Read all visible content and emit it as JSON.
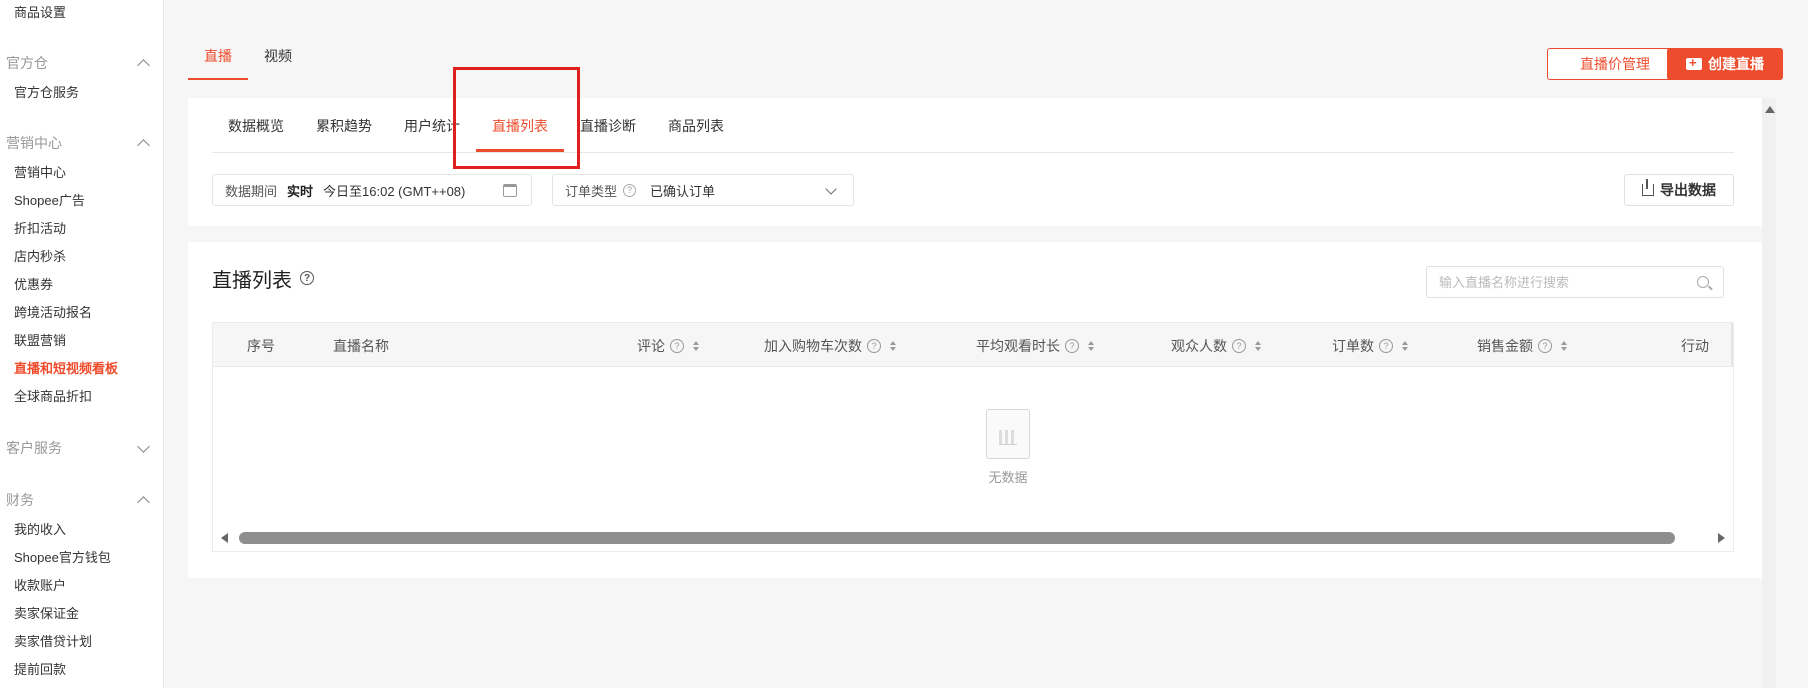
{
  "sidebar": {
    "top_item": "商品设置",
    "groups": [
      {
        "title": "官方仓",
        "expanded": true,
        "items": [
          "官方仓服务"
        ]
      },
      {
        "title": "营销中心",
        "expanded": true,
        "items": [
          "营销中心",
          "Shopee广告",
          "折扣活动",
          "店内秒杀",
          "优惠券",
          "跨境活动报名",
          "联盟营销",
          "直播和短视频看板",
          "全球商品折扣"
        ],
        "active_item": "直播和短视频看板"
      },
      {
        "title": "客户服务",
        "expanded": false,
        "items": []
      },
      {
        "title": "财务",
        "expanded": true,
        "items": [
          "我的收入",
          "Shopee官方钱包",
          "收款账户",
          "卖家保证金",
          "卖家借贷计划",
          "提前回款"
        ]
      }
    ]
  },
  "top_tabs": [
    {
      "label": "直播",
      "active": true
    },
    {
      "label": "视频",
      "active": false
    }
  ],
  "actions": {
    "price_mgmt_label": "直播价管理",
    "create_live_label": "创建直播"
  },
  "sub_tabs": [
    {
      "label": "数据概览",
      "active": false
    },
    {
      "label": "累积趋势",
      "active": false
    },
    {
      "label": "用户统计",
      "active": false
    },
    {
      "label": "直播列表",
      "active": true
    },
    {
      "label": "直播诊断",
      "active": false
    },
    {
      "label": "商品列表",
      "active": false
    }
  ],
  "filters": {
    "period_label": "数据期间",
    "period_mode": "实时",
    "period_value": "今日至16:02 (GMT++08)",
    "order_type_label": "订单类型",
    "order_type_value": "已确认订单",
    "export_label": "导出数据"
  },
  "list": {
    "title": "直播列表",
    "search_placeholder": "输入直播名称进行搜索",
    "columns": [
      {
        "label": "序号",
        "help": false,
        "sortable": false
      },
      {
        "label": "直播名称",
        "help": false,
        "sortable": false
      },
      {
        "label": "评论",
        "help": true,
        "sortable": true
      },
      {
        "label": "加入购物车次数",
        "help": true,
        "sortable": true
      },
      {
        "label": "平均观看时长",
        "help": true,
        "sortable": true
      },
      {
        "label": "观众人数",
        "help": true,
        "sortable": true
      },
      {
        "label": "订单数",
        "help": true,
        "sortable": true
      },
      {
        "label": "销售金额",
        "help": true,
        "sortable": true
      },
      {
        "label": "行动",
        "help": false,
        "sortable": false
      }
    ],
    "rows": [],
    "empty_text": "无数据"
  },
  "colors": {
    "accent": "#ee4d2d",
    "highlight": "#e01f1f"
  }
}
